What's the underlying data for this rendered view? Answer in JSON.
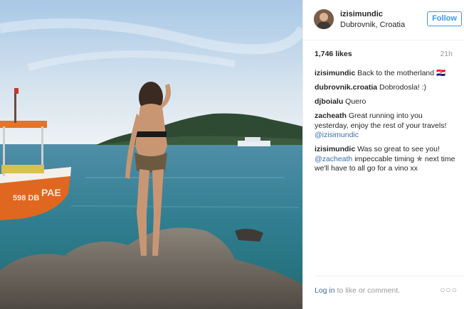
{
  "post": {
    "photo": {
      "icon": "beach-photo"
    },
    "author": {
      "username": "izisimundic",
      "location": "Dubrovnik, Croatia"
    },
    "follow_label": "Follow",
    "likes": "1,746 likes",
    "age": "21h",
    "comments": [
      {
        "user": "izisimundic",
        "text": "Back to the motherland 🇭🇷"
      },
      {
        "user": "dubrovnik.croatia",
        "text": "Dobrodosla! :)"
      },
      {
        "user": "djboialu",
        "text": "Quero"
      },
      {
        "user": "zacheath",
        "text": "Great running into you yesterday, enjoy the rest of your travels! ",
        "mention": "@izisimundic"
      },
      {
        "user": "izisimundic",
        "text": "Was so great to see you! ",
        "mention": "@zacheath",
        "text_after": " impeccable timing ✯ next time we'll have to all go for a vino xx"
      }
    ],
    "footer": {
      "login_link": "Log in",
      "login_text": " to like or comment.",
      "more_icon": "more-options-icon",
      "more_glyph": "○○○"
    }
  }
}
